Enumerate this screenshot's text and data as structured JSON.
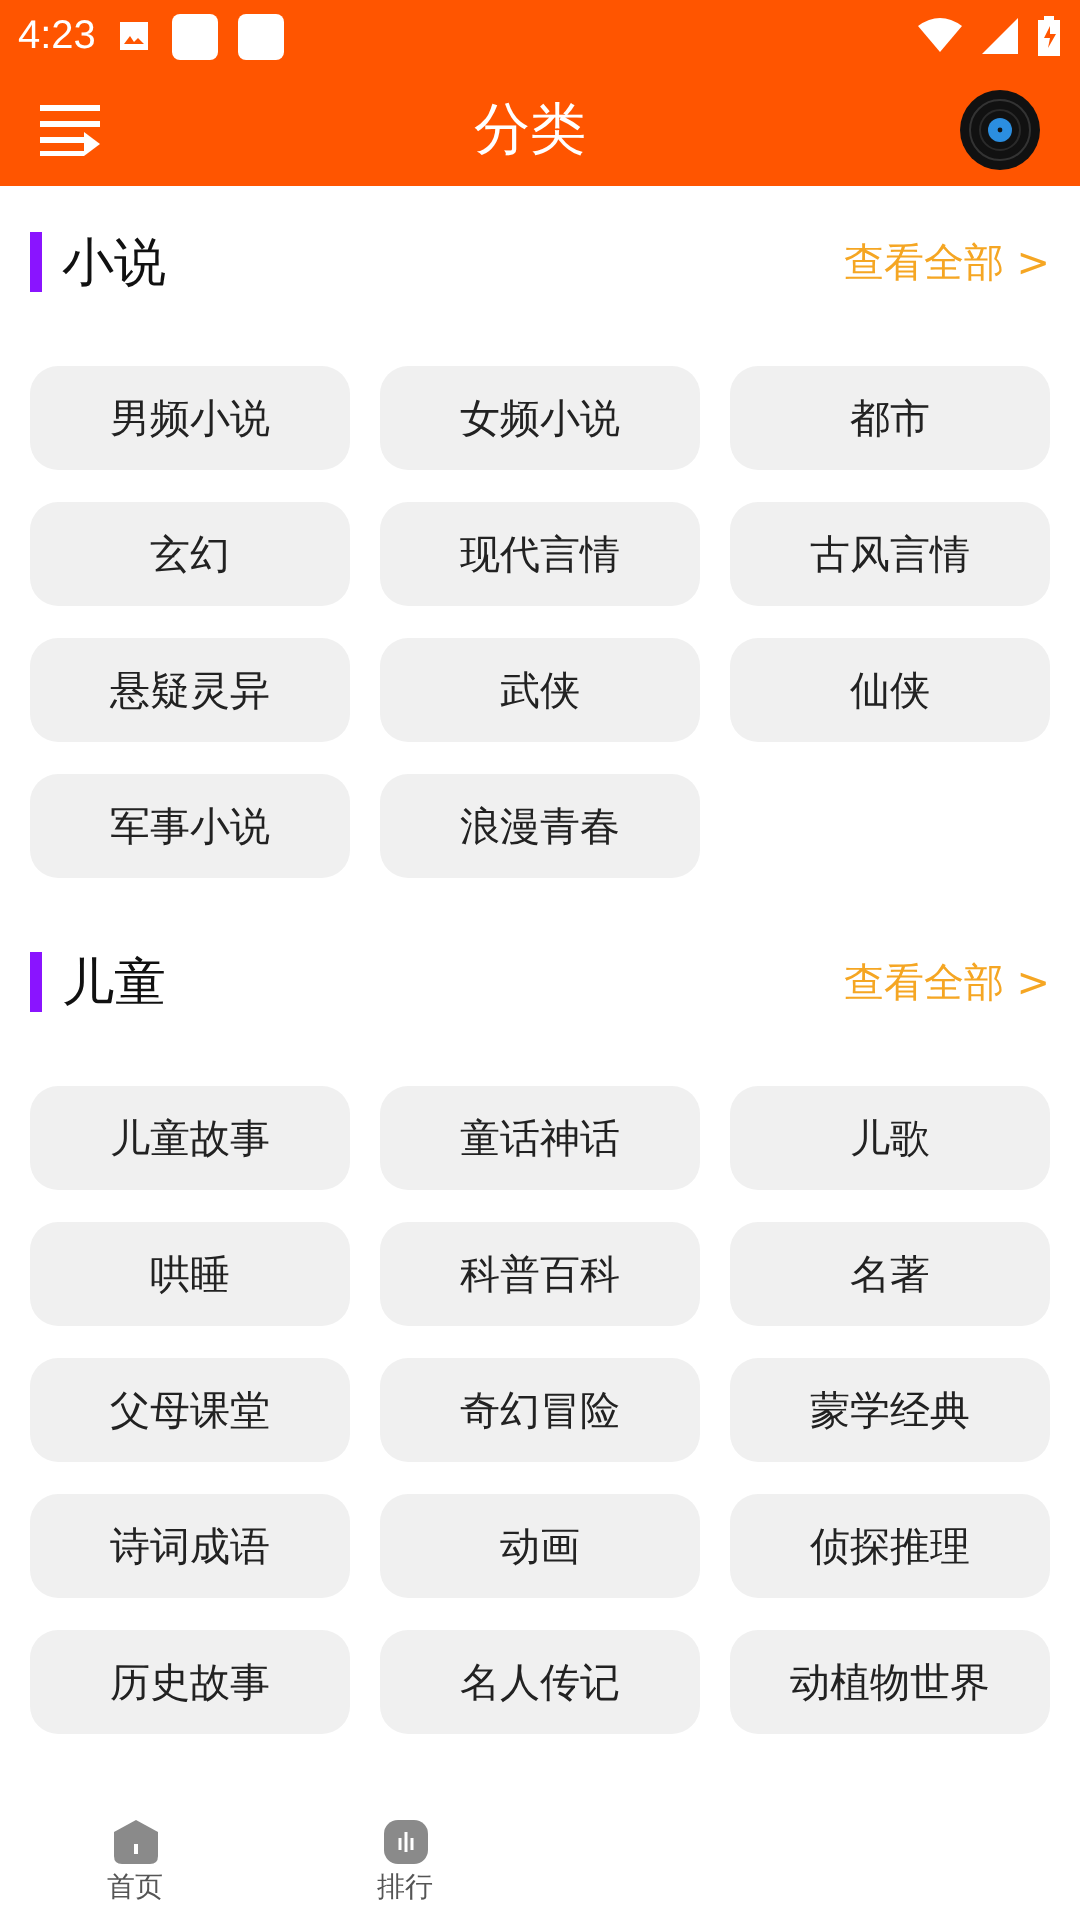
{
  "status_bar": {
    "time": "4:23"
  },
  "header": {
    "title": "分类"
  },
  "sections": [
    {
      "title": "小说",
      "more": "查看全部 >",
      "items": [
        "男频小说",
        "女频小说",
        "都市",
        "玄幻",
        "现代言情",
        "古风言情",
        "悬疑灵异",
        "武侠",
        "仙侠",
        "军事小说",
        "浪漫青春"
      ]
    },
    {
      "title": "儿童",
      "more": "查看全部 >",
      "items": [
        "儿童故事",
        "童话神话",
        "儿歌",
        "哄睡",
        "科普百科",
        "名著",
        "父母课堂",
        "奇幻冒险",
        "蒙学经典",
        "诗词成语",
        "动画",
        "侦探推理",
        "历史故事",
        "名人传记",
        "动植物世界"
      ]
    }
  ],
  "bottom_nav": [
    {
      "label": "首页",
      "kind": "home"
    },
    {
      "label": "排行",
      "kind": "rank"
    }
  ]
}
